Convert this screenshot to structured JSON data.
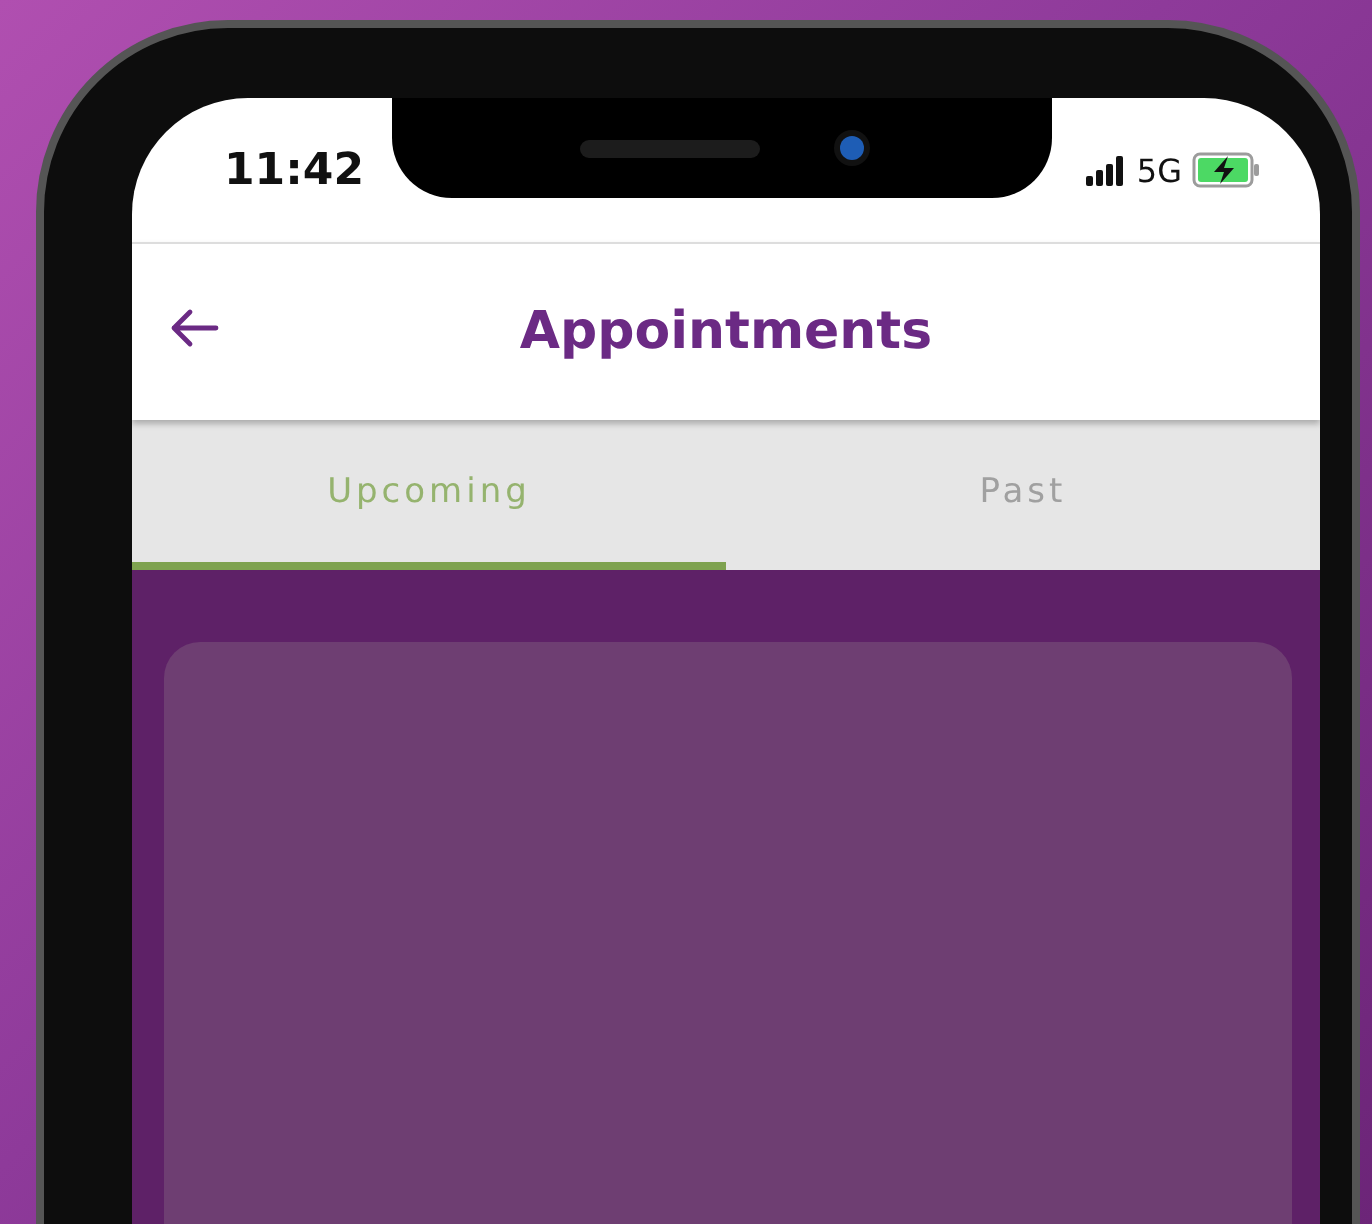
{
  "status_bar": {
    "time": "11:42",
    "network": "5G"
  },
  "header": {
    "title": "Appointments"
  },
  "tabs": [
    {
      "label": "Upcoming",
      "selected": true
    },
    {
      "label": "Past",
      "selected": false
    }
  ]
}
